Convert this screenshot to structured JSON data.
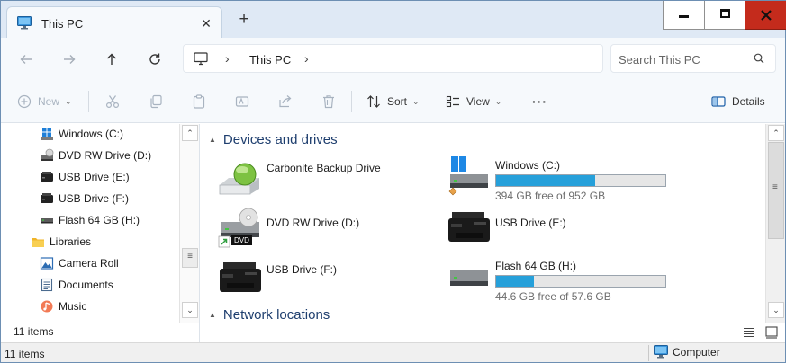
{
  "window": {
    "tab_title": "This PC",
    "tab_close": "✕",
    "new_tab": "+"
  },
  "address": {
    "crumbs": [
      "This PC"
    ],
    "chevron": "›",
    "search_placeholder": "Search This PC"
  },
  "commands": {
    "new_label": "New",
    "sort_label": "Sort",
    "view_label": "View",
    "more_label": "···",
    "details_label": "Details"
  },
  "sidebar": {
    "items": [
      {
        "label": "Windows (C:)",
        "icon": "windows-drive-icon"
      },
      {
        "label": "DVD RW Drive (D:)",
        "icon": "dvd-drive-icon"
      },
      {
        "label": "USB Drive (E:)",
        "icon": "printer-drive-icon"
      },
      {
        "label": "USB Drive (F:)",
        "icon": "printer-drive-icon"
      },
      {
        "label": "Flash 64 GB (H:)",
        "icon": "flash-drive-icon"
      },
      {
        "label": "Libraries",
        "icon": "libraries-folder-icon"
      },
      {
        "label": "Camera Roll",
        "icon": "camera-roll-icon"
      },
      {
        "label": "Documents",
        "icon": "documents-icon"
      },
      {
        "label": "Music",
        "icon": "music-icon"
      }
    ],
    "item_count": "11 items"
  },
  "main": {
    "groups": {
      "devices": "Devices and drives",
      "network": "Network locations"
    },
    "drives": [
      {
        "name": "Carbonite Backup Drive",
        "icon": "backup-drive-icon"
      },
      {
        "name": "Windows (C:)",
        "icon": "windows-drive-icon",
        "free": "394 GB free of 952 GB",
        "used_fraction": 0.586
      },
      {
        "name": "DVD RW Drive (D:)",
        "icon": "dvd-drive-icon",
        "badge": "DVD"
      },
      {
        "name": "USB Drive (E:)",
        "icon": "printer-drive-icon"
      },
      {
        "name": "USB Drive (F:)",
        "icon": "printer-drive-icon"
      },
      {
        "name": "Flash 64 GB (H:)",
        "icon": "flash-drive-icon",
        "free": "44.6 GB free of 57.6 GB",
        "used_fraction": 0.226
      }
    ]
  },
  "statusbar": {
    "items": "11 items",
    "location": "Computer"
  },
  "colors": {
    "accent": "#26a0da",
    "close_button": "#c42b1c",
    "header_text": "#1e3e6e"
  }
}
